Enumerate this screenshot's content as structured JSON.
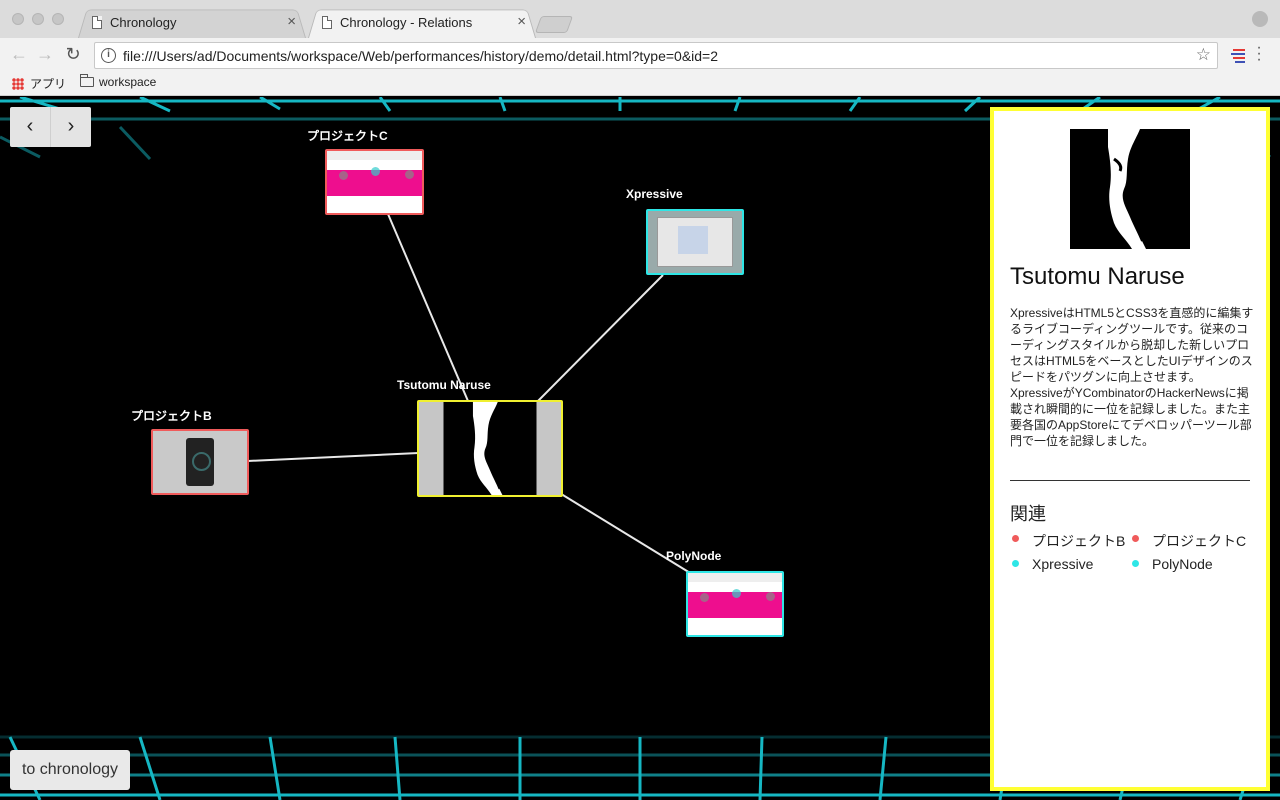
{
  "browser": {
    "tabs": [
      {
        "title": "Chronology",
        "active": false
      },
      {
        "title": "Chronology - Relations",
        "active": true
      }
    ],
    "url": "file:///Users/ad/Documents/workspace/Web/performances/history/demo/detail.html?type=0&id=2",
    "bookmarks": [
      {
        "label": "アプリ",
        "icon": "apps-grid-icon"
      },
      {
        "label": "workspace",
        "icon": "folder-icon"
      }
    ]
  },
  "graph": {
    "center": {
      "label": "Tsutomu Naruse",
      "color": "#f0f030"
    },
    "nodes": [
      {
        "label": "プロジェクトC",
        "color": "#f05b5b"
      },
      {
        "label": "Xpressive",
        "color": "#2ee6e6"
      },
      {
        "label": "プロジェクトB",
        "color": "#f05b5b"
      },
      {
        "label": "PolyNode",
        "color": "#2ee6e6"
      }
    ]
  },
  "controls": {
    "prev_label": "‹",
    "next_label": "›",
    "to_chronology_label": "to chronology"
  },
  "detail": {
    "name": "Tsutomu Naruse",
    "description": "XpressiveはHTML5とCSS3を直感的に編集するライブコーディングツールです。従来のコーディングスタイルから脱却した新しいプロセスはHTML5をベースとしたUIデザインのスピードをパツグンに向上させます。 XpressiveがYCombinatorのHackerNewsに掲載され瞬間的に一位を記録しました。また主要各国のAppStoreにてデベロッパーツール部門で一位を記録しました。",
    "related_title": "関連",
    "related": [
      {
        "label": "プロジェクトB",
        "color": "#f05b5b"
      },
      {
        "label": "プロジェクトC",
        "color": "#f05b5b"
      },
      {
        "label": "Xpressive",
        "color": "#2ee6e6"
      },
      {
        "label": "PolyNode",
        "color": "#2ee6e6"
      }
    ]
  },
  "colors": {
    "accent_yellow": "#ffff33",
    "project_red": "#f05b5b",
    "product_cyan": "#2ee6e6",
    "grid_glow": "#1ad7e6"
  }
}
